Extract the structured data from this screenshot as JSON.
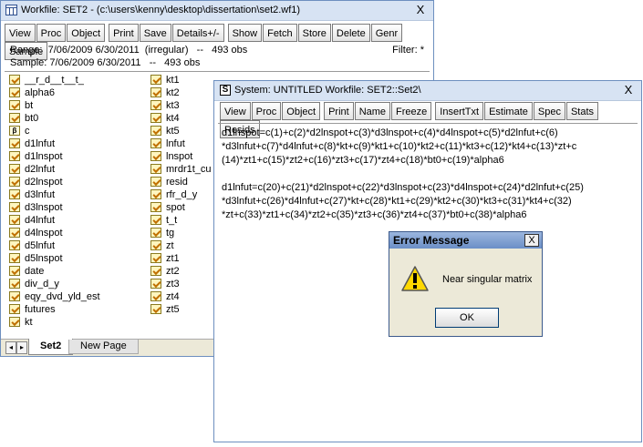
{
  "workfile": {
    "title": "Workfile: SET2 - (c:\\users\\kenny\\desktop\\dissertation\\set2.wf1)",
    "close": "X",
    "toolbar": [
      "View",
      "Proc",
      "Object",
      "Print",
      "Save",
      "Details+/-",
      "Show",
      "Fetch",
      "Store",
      "Delete",
      "Genr",
      "Sample"
    ],
    "range_line": "Range:  7/06/2009 6/30/2011  (irregular)   --   493 obs",
    "filter": "Filter: *",
    "sample_line": "Sample: 7/06/2009 6/30/2011   --   493 obs",
    "objects_col1": [
      {
        "name": "__r_d__t__t_",
        "type": "series"
      },
      {
        "name": "alpha6",
        "type": "series"
      },
      {
        "name": "bt",
        "type": "series"
      },
      {
        "name": "bt0",
        "type": "series"
      },
      {
        "name": "c",
        "type": "coef"
      },
      {
        "name": "d1lnfut",
        "type": "series"
      },
      {
        "name": "d1lnspot",
        "type": "series"
      },
      {
        "name": "d2lnfut",
        "type": "series"
      },
      {
        "name": "d2lnspot",
        "type": "series"
      },
      {
        "name": "d3lnfut",
        "type": "series"
      },
      {
        "name": "d3lnspot",
        "type": "series"
      },
      {
        "name": "d4lnfut",
        "type": "series"
      },
      {
        "name": "d4lnspot",
        "type": "series"
      },
      {
        "name": "d5lnfut",
        "type": "series"
      },
      {
        "name": "d5lnspot",
        "type": "series"
      },
      {
        "name": "date",
        "type": "series"
      },
      {
        "name": "div_d_y",
        "type": "series"
      },
      {
        "name": "eqy_dvd_yld_est",
        "type": "series"
      },
      {
        "name": "futures",
        "type": "series"
      },
      {
        "name": "kt",
        "type": "series"
      }
    ],
    "objects_col2": [
      {
        "name": "kt1",
        "type": "series"
      },
      {
        "name": "kt2",
        "type": "series"
      },
      {
        "name": "kt3",
        "type": "series"
      },
      {
        "name": "kt4",
        "type": "series"
      },
      {
        "name": "kt5",
        "type": "series"
      },
      {
        "name": "lnfut",
        "type": "series"
      },
      {
        "name": "lnspot",
        "type": "series"
      },
      {
        "name": "mrdr1t_cu",
        "type": "series"
      },
      {
        "name": "resid",
        "type": "series"
      },
      {
        "name": "rfr_d_y",
        "type": "series"
      },
      {
        "name": "spot",
        "type": "series"
      },
      {
        "name": "t_t",
        "type": "series"
      },
      {
        "name": "tg",
        "type": "series"
      },
      {
        "name": "zt",
        "type": "series"
      },
      {
        "name": "zt1",
        "type": "series"
      },
      {
        "name": "zt2",
        "type": "series"
      },
      {
        "name": "zt3",
        "type": "series"
      },
      {
        "name": "zt4",
        "type": "series"
      },
      {
        "name": "zt5",
        "type": "series"
      }
    ],
    "tabs": [
      "Set2",
      "New Page"
    ]
  },
  "system": {
    "title": "System: UNTITLED    Workfile: SET2::Set2\\",
    "close": "X",
    "toolbar": [
      "View",
      "Proc",
      "Object",
      "Print",
      "Name",
      "Freeze",
      "InsertTxt",
      "Estimate",
      "Spec",
      "Stats",
      "Resids"
    ],
    "equations": [
      "d1lnspot=c(1)+c(2)*d2lnspot+c(3)*d3lnspot+c(4)*d4lnspot+c(5)*d2lnfut+c(6)",
      "*d3lnfut+c(7)*d4lnfut+c(8)*kt+c(9)*kt1+c(10)*kt2+c(11)*kt3+c(12)*kt4+c(13)*zt+c",
      "(14)*zt1+c(15)*zt2+c(16)*zt3+c(17)*zt4+c(18)*bt0+c(19)*alpha6",
      "",
      "d1lnfut=c(20)+c(21)*d2lnspot+c(22)*d3lnspot+c(23)*d4lnspot+c(24)*d2lnfut+c(25)",
      "*d3lnfut+c(26)*d4lnfut+c(27)*kt+c(28)*kt1+c(29)*kt2+c(30)*kt3+c(31)*kt4+c(32)",
      "*zt+c(33)*zt1+c(34)*zt2+c(35)*zt3+c(36)*zt4+c(37)*bt0+c(38)*alpha6"
    ]
  },
  "dialog": {
    "title": "Error Message",
    "close": "X",
    "message": "Near singular matrix",
    "ok": "OK"
  }
}
